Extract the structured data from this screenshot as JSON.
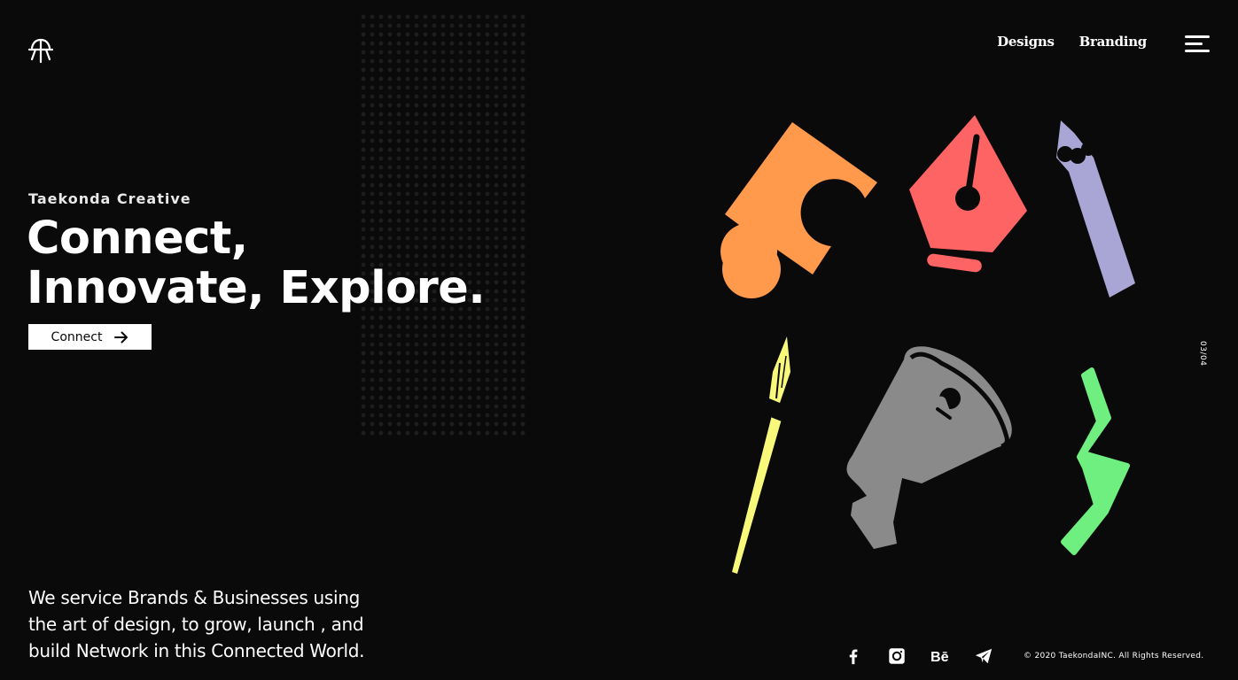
{
  "header": {
    "logo_alt": "TaekondaINC logo",
    "nav": [
      {
        "label": "Designs"
      },
      {
        "label": "Branding"
      }
    ]
  },
  "hero": {
    "kicker": "Taekonda Creative",
    "headline_line1": "Connect,",
    "headline_line2": "Innovate, Explore.",
    "cta_label": "Connect"
  },
  "blurb": {
    "line1": "We service Brands & Businesses using",
    "line2": "the art of design, to grow, launch , and",
    "line3": "build Network in this Connected World."
  },
  "slide_counter": "03/04",
  "footer": {
    "social": [
      "facebook-icon",
      "instagram-icon",
      "behance-icon",
      "telegram-icon"
    ],
    "copyright": "© 2020 TaekondaINC. All Rights Reserved."
  },
  "colors": {
    "background": "#0a0a0a",
    "puzzle": "#ff9a4d",
    "pen_nib": "#ff6464",
    "pencil": "#a9a6d6",
    "brush": "#f8f97a",
    "megaphone": "#8a8a8a",
    "squiggle": "#6fef7f"
  }
}
